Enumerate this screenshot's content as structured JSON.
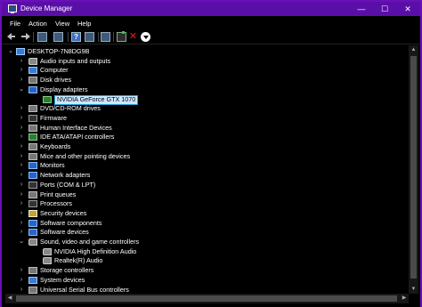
{
  "window": {
    "title": "Device Manager",
    "accent_color": "#5a0ea8",
    "controls": {
      "minimize": "—",
      "maximize": "☐",
      "close": "✕"
    }
  },
  "menu": [
    "File",
    "Action",
    "View",
    "Help"
  ],
  "toolbar": {
    "buttons": [
      "back-icon",
      "forward-icon",
      "properties-icon",
      "show-hide-icon",
      "help-icon",
      "scan-icon",
      "update-driver-icon",
      "uninstall-icon",
      "download-icon"
    ]
  },
  "tree": {
    "root": "DESKTOP-7N8DG9B",
    "items": [
      {
        "label": "Audio inputs and outputs",
        "expanded": false,
        "icon": "speaker-icon"
      },
      {
        "label": "Computer",
        "expanded": false,
        "icon": "computer-icon"
      },
      {
        "label": "Disk drives",
        "expanded": false,
        "icon": "disk-icon"
      },
      {
        "label": "Display adapters",
        "expanded": true,
        "icon": "monitor-icon"
      },
      {
        "label": "NVIDIA GeForce GTX 1070",
        "child": true,
        "selected": true,
        "icon": "display-adapter-icon"
      },
      {
        "label": "DVD/CD-ROM drives",
        "expanded": false,
        "icon": "dvd-icon"
      },
      {
        "label": "Firmware",
        "expanded": false,
        "icon": "chip-icon"
      },
      {
        "label": "Human Interface Devices",
        "expanded": false,
        "icon": "hid-icon"
      },
      {
        "label": "IDE ATA/ATAPI controllers",
        "expanded": false,
        "icon": "controller-icon"
      },
      {
        "label": "Keyboards",
        "expanded": false,
        "icon": "keyboard-icon"
      },
      {
        "label": "Mice and other pointing devices",
        "expanded": false,
        "icon": "mouse-icon"
      },
      {
        "label": "Monitors",
        "expanded": false,
        "icon": "monitor-icon"
      },
      {
        "label": "Network adapters",
        "expanded": false,
        "icon": "network-icon"
      },
      {
        "label": "Ports (COM & LPT)",
        "expanded": false,
        "icon": "port-icon"
      },
      {
        "label": "Print queues",
        "expanded": false,
        "icon": "printer-icon"
      },
      {
        "label": "Processors",
        "expanded": false,
        "icon": "cpu-icon"
      },
      {
        "label": "Security devices",
        "expanded": false,
        "icon": "security-icon"
      },
      {
        "label": "Software components",
        "expanded": false,
        "icon": "puzzle-icon"
      },
      {
        "label": "Software devices",
        "expanded": false,
        "icon": "puzzle-icon"
      },
      {
        "label": "Sound, video and game controllers",
        "expanded": true,
        "icon": "speaker-icon"
      },
      {
        "label": "NVIDIA High Definition Audio",
        "child": true,
        "icon": "speaker-icon"
      },
      {
        "label": "Realtek(R) Audio",
        "child": true,
        "icon": "speaker-icon"
      },
      {
        "label": "Storage controllers",
        "expanded": false,
        "icon": "storage-icon"
      },
      {
        "label": "System devices",
        "expanded": false,
        "icon": "computer-icon"
      },
      {
        "label": "Universal Serial Bus controllers",
        "expanded": false,
        "icon": "usb-icon"
      }
    ]
  }
}
